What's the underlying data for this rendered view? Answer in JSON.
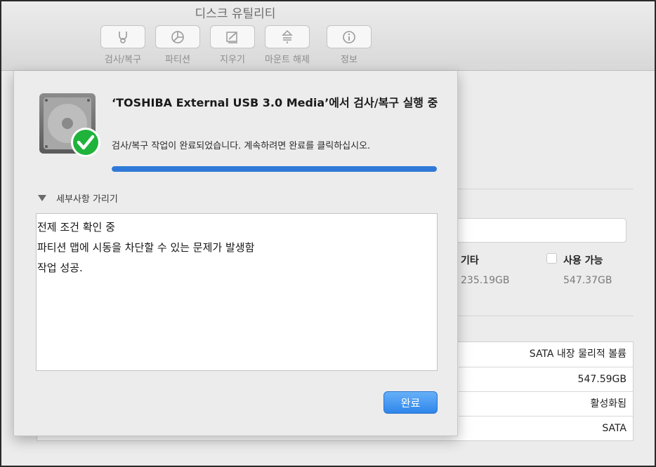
{
  "window": {
    "title": "디스크 유틸리티"
  },
  "toolbar": {
    "buttons": [
      {
        "label": "검사/복구",
        "icon": "stethoscope-icon"
      },
      {
        "label": "파티션",
        "icon": "partition-pie-icon"
      },
      {
        "label": "지우기",
        "icon": "erase-icon"
      },
      {
        "label": "마운트 해제",
        "icon": "eject-icon"
      },
      {
        "label": "정보",
        "icon": "info-icon"
      }
    ]
  },
  "background": {
    "legend_other_label": "기타",
    "legend_other_value": "235.19GB",
    "legend_available_label": "사용 가능",
    "legend_available_value": "547.37GB",
    "info_rows": [
      "SATA 내장 물리적 볼륨",
      "547.59GB",
      "활성화됨",
      "SATA"
    ]
  },
  "sheet": {
    "title": "‘TOSHIBA External USB 3.0 Media’에서 검사/복구 실행 중",
    "message": "검사/복구 작업이 완료되었습니다. 계속하려면 완료를 클릭하십시오.",
    "progress_percent": 100,
    "details_toggle_label": "세부사항 가리기",
    "log_lines": [
      "전제 조건 확인 중",
      "파티션 맵에 시동을 차단할 수 있는 문제가 발생함",
      "작업 성공."
    ],
    "done_label": "완료"
  },
  "colors": {
    "progress": "#2f7ad8",
    "done_button": "#2f86ea",
    "check_badge": "#1fb33b"
  }
}
